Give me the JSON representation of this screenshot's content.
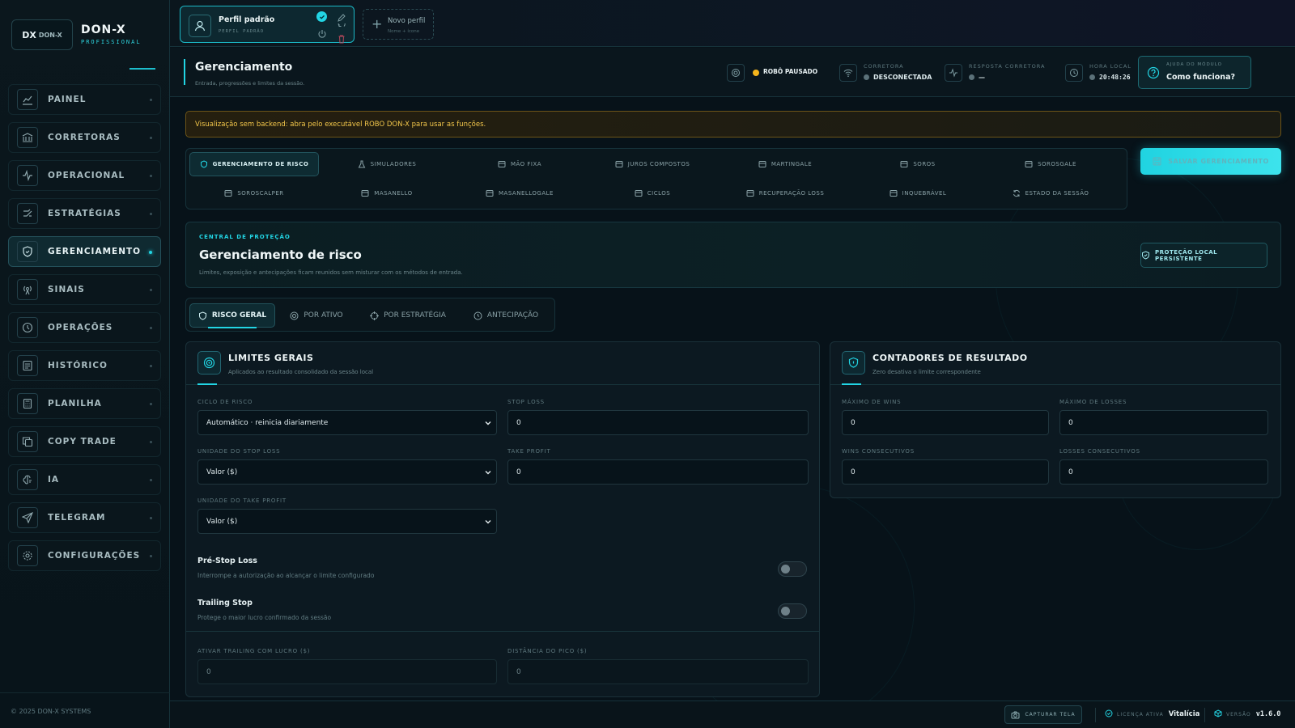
{
  "brand": {
    "logo": "DX",
    "logo_small": "DON-X",
    "name": "DON-X",
    "subtitle": "PROFISSIONAL"
  },
  "sidebar": {
    "items": [
      {
        "label": "PAINEL",
        "icon": "chart-line-icon"
      },
      {
        "label": "CORRETORAS",
        "icon": "bank-icon"
      },
      {
        "label": "OPERACIONAL",
        "icon": "activity-icon"
      },
      {
        "label": "ESTRATÉGIAS",
        "icon": "strategy-icon"
      },
      {
        "label": "GERENCIAMENTO",
        "icon": "shield-icon",
        "active": true
      },
      {
        "label": "SINAIS",
        "icon": "radio-signal-icon"
      },
      {
        "label": "OPERAÇÕES",
        "icon": "history-clock-icon"
      },
      {
        "label": "HISTÓRICO",
        "icon": "list-icon"
      },
      {
        "label": "PLANILHA",
        "icon": "calculator-icon"
      },
      {
        "label": "COPY TRADE",
        "icon": "copy-icon"
      },
      {
        "label": "IA",
        "icon": "brain-icon"
      },
      {
        "label": "TELEGRAM",
        "icon": "send-icon"
      },
      {
        "label": "CONFIGURAÇÕES",
        "icon": "gear-icon"
      }
    ],
    "footer": "© 2025 DON-X SYSTEMS"
  },
  "topbar": {
    "profile": {
      "name": "Perfil padrão",
      "sub": "PERFIL PADRÃO"
    },
    "new_profile": {
      "label": "Novo perfil",
      "sub": "Nome + ícone"
    }
  },
  "header": {
    "title": "Gerenciamento",
    "subtitle": "Entrada, progressões e limites da sessão.",
    "robot_status": "ROBÔ PAUSADO",
    "broker_label": "CORRETORA",
    "broker_value": "DESCONECTADA",
    "response_label": "RESPOSTA CORRETORA",
    "response_value": "—",
    "time_label": "HORA LOCAL",
    "time_value": "20:48:26",
    "help_label": "AJUDA DO MÓDULO",
    "help_value": "Como funciona?"
  },
  "warning": "Visualização sem backend: abra pelo executável ROBO DON-X para usar as funções.",
  "module_tabs": {
    "row1": [
      "GERENCIAMENTO DE RISCO",
      "SIMULADORES",
      "MÃO FIXA",
      "JUROS COMPOSTOS",
      "MARTINGALE",
      "SOROS",
      "SOROSGALE"
    ],
    "row2": [
      "SOROSCALPER",
      "MASANELLO",
      "MASANELLOGALE",
      "CICLOS",
      "RECUPERAÇÃO LOSS",
      "INQUEBRÁVEL",
      "ESTADO DA SESSÃO"
    ]
  },
  "save_button": "SALVAR GERENCIAMENTO",
  "protection": {
    "kicker": "CENTRAL DE PROTEÇÃO",
    "title": "Gerenciamento de risco",
    "subtitle": "Limites, exposição e antecipações ficam reunidos sem misturar com os métodos de entrada.",
    "badge": "PROTEÇÃO LOCAL PERSISTENTE"
  },
  "sub_tabs": [
    "RISCO GERAL",
    "POR ATIVO",
    "POR ESTRATÉGIA",
    "ANTECIPAÇÃO"
  ],
  "limits": {
    "title": "LIMITES GERAIS",
    "subtitle": "Aplicados ao resultado consolidado da sessão local",
    "cycle_label": "CICLO DE RISCO",
    "cycle_value": "Automático · reinicia diariamente",
    "stop_loss_label": "STOP LOSS",
    "stop_loss_value": "0",
    "sl_unit_label": "UNIDADE DO STOP LOSS",
    "sl_unit_value": "Valor ($)",
    "take_profit_label": "TAKE PROFIT",
    "take_profit_value": "0",
    "tp_unit_label": "UNIDADE DO TAKE PROFIT",
    "tp_unit_value": "Valor ($)",
    "prestop_title": "Pré-Stop Loss",
    "prestop_sub": "Interrompe a autorização ao alcançar o limite configurado",
    "trailing_title": "Trailing Stop",
    "trailing_sub": "Protege o maior lucro confirmado da sessão",
    "trail_activate_label": "ATIVAR TRAILING COM LUCRO ($)",
    "trail_activate_value": "0",
    "peak_distance_label": "DISTÂNCIA DO PICO ($)",
    "peak_distance_value": "0"
  },
  "counters": {
    "title": "CONTADORES DE RESULTADO",
    "subtitle": "Zero desativa o limite correspondente",
    "max_wins_label": "MÁXIMO DE WINS",
    "max_wins_value": "0",
    "max_losses_label": "MÁXIMO DE LOSSES",
    "max_losses_value": "0",
    "cons_wins_label": "WINS CONSECUTIVOS",
    "cons_wins_value": "0",
    "cons_losses_label": "LOSSES CONSECUTIVOS",
    "cons_losses_value": "0"
  },
  "footer": {
    "capture": "CAPTURAR TELA",
    "license_label": "LICENÇA ATIVA",
    "license_value": "Vitalícia",
    "version_label": "VERSÃO",
    "version_value": "v1.6.0"
  },
  "colors": {
    "accent": "#22d5e4",
    "warning": "#f2c64a",
    "status_paused": "#f5b51c",
    "background": "#071219"
  }
}
